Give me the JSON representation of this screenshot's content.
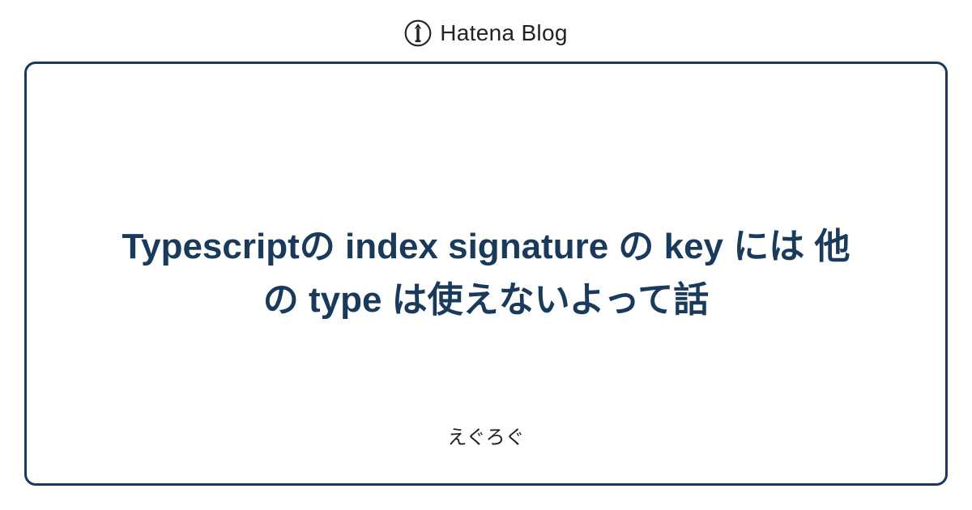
{
  "header": {
    "brand": "Hatena Blog"
  },
  "card": {
    "title": "Typescriptの index signature の key には 他の type は使えないよって話",
    "subtitle": "えぐろぐ"
  },
  "colors": {
    "brand_border": "#1a3a5c",
    "text_dark": "#222222"
  }
}
